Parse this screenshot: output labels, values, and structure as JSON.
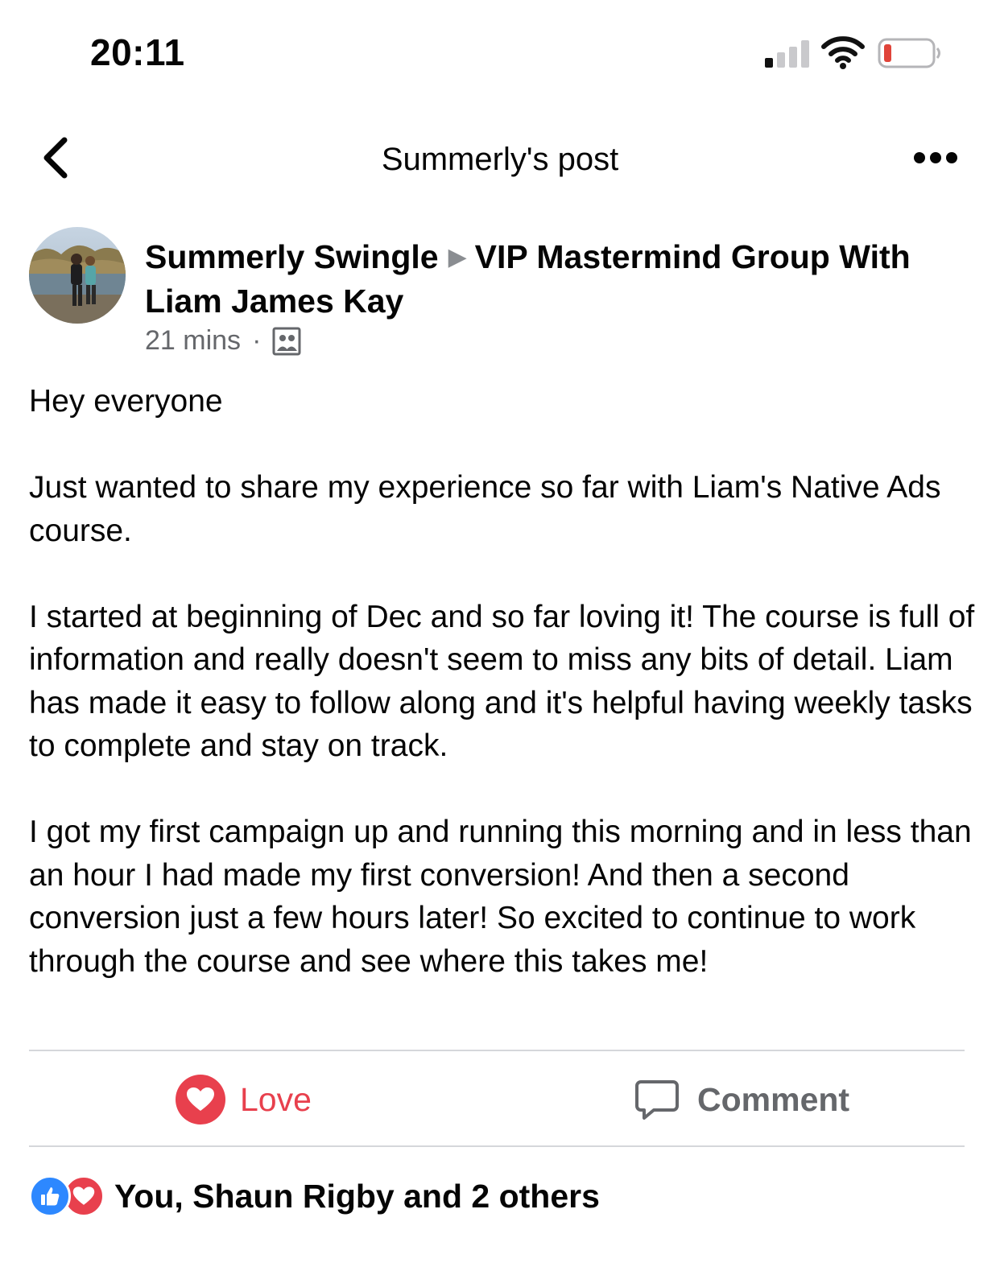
{
  "status_bar": {
    "time": "20:11",
    "icons": [
      "cellular-signal-icon",
      "wifi-icon",
      "battery-low-icon"
    ],
    "battery_color": "#e0443a"
  },
  "nav": {
    "title": "Summerly's post",
    "back_icon": "chevron-left-icon",
    "more_icon": "more-horizontal-icon"
  },
  "post": {
    "author": "Summerly Swingle",
    "separator_icon": "triangle-right-icon",
    "group": "VIP Mastermind Group With Liam James Kay",
    "time": "21 mins",
    "audience_icon": "group-icon",
    "paragraphs": [
      "Hey everyone",
      "Just wanted to share my experience so far with Liam's Native Ads course.",
      "I started at beginning of Dec and so far loving it! The course is full of information and really doesn't seem to miss any bits of detail. Liam has made it easy to follow along and it's helpful having weekly tasks to complete and stay on track.",
      "I got my first campaign up and running this morning and in less than an hour I had made my first conversion! And then a second conversion just a few hours later! So excited to continue to work through the course and see where this takes me!"
    ]
  },
  "actions": {
    "love_label": "Love",
    "comment_label": "Comment",
    "love_color": "#e8404d"
  },
  "reactions": {
    "icons": [
      "like-icon",
      "love-icon"
    ],
    "summary": "You, Shaun Rigby and 2 others"
  }
}
